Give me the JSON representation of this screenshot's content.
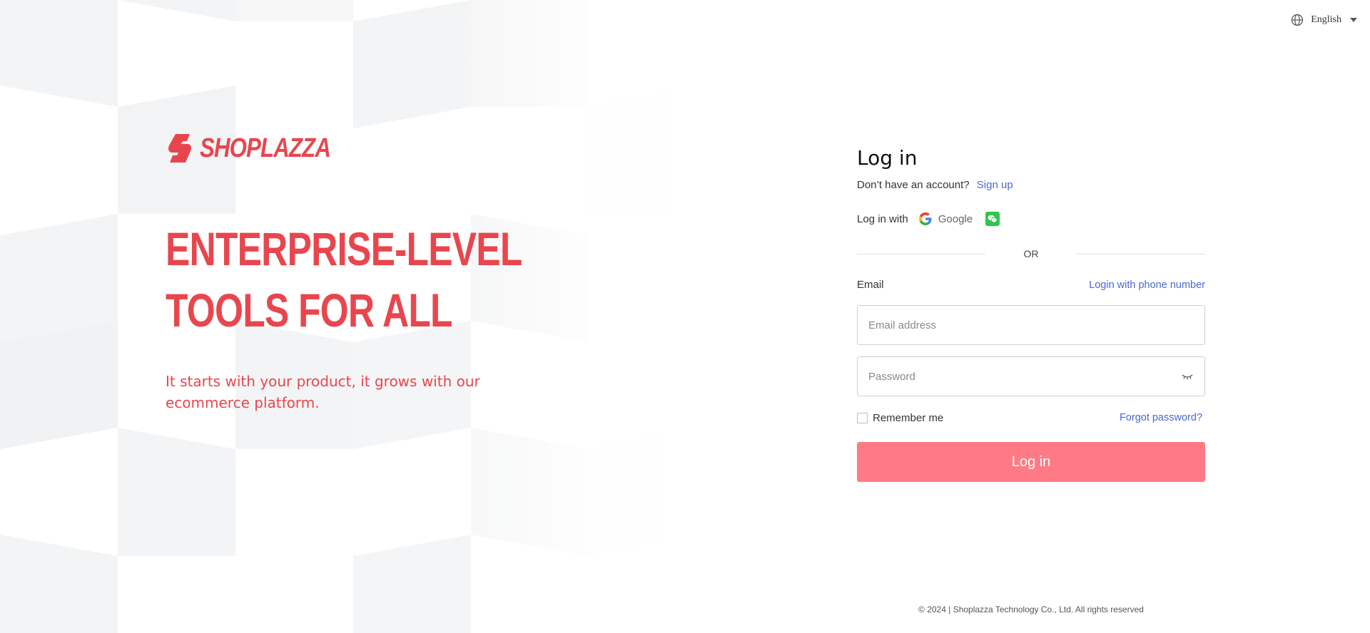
{
  "colors": {
    "brand": "#e8464e",
    "link": "#4a67d6",
    "primary_button": "#ff7a85",
    "wechat": "#2bc84a"
  },
  "language": {
    "label": "English",
    "icon": "globe-icon"
  },
  "brand": {
    "name": "SHOPLAZZA",
    "icon": "shoplazza-logo-icon"
  },
  "hero": {
    "headline_line1": "ENTERPRISE-LEVEL",
    "headline_line2": "TOOLS FOR ALL",
    "tagline": "It starts with your product, it grows with our ecommerce platform."
  },
  "login": {
    "title": "Log in",
    "no_account_text": "Don’t have an account?",
    "signup_link": "Sign up",
    "login_with_text": "Log in with",
    "google_label": "Google",
    "or_text": "OR",
    "email_label": "Email",
    "phone_login_link": "Login with phone number",
    "email_placeholder": "Email address",
    "password_placeholder": "Password",
    "remember_me": "Remember me",
    "forgot_password": "Forgot password?",
    "submit_label": "Log in"
  },
  "footer": {
    "copyright": "© 2024 | Shoplazza Technology Co., Ltd. All rights reserved"
  }
}
